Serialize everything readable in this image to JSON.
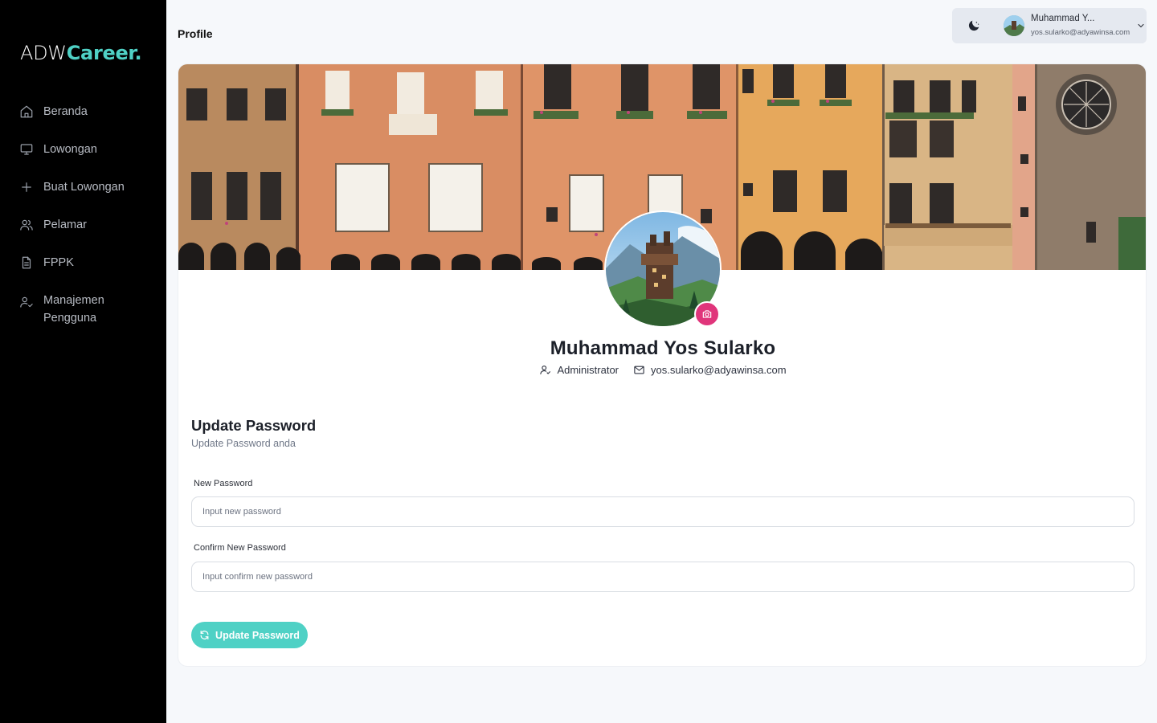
{
  "brand": {
    "prefix": "ADW",
    "accent": "Career."
  },
  "sidebar": {
    "items": [
      {
        "label": "Beranda",
        "icon": "home-icon"
      },
      {
        "label": "Lowongan",
        "icon": "monitor-icon"
      },
      {
        "label": "Buat Lowongan",
        "icon": "plus-icon"
      },
      {
        "label": "Pelamar",
        "icon": "users-icon"
      },
      {
        "label": "FPPK",
        "icon": "document-icon"
      },
      {
        "label": "Manajemen Pengguna",
        "icon": "user-check-icon"
      }
    ]
  },
  "header": {
    "title": "Profile",
    "user_name": "Muhammad Y...",
    "user_email": "yos.sularko@adyawinsa.com",
    "theme_icon": "moon-icon",
    "menu_icon": "chevron-down-icon"
  },
  "profile": {
    "name": "Muhammad Yos Sularko",
    "role": "Administrator",
    "email": "yos.sularko@adyawinsa.com",
    "camera_icon": "camera-icon"
  },
  "password_form": {
    "title": "Update Password",
    "subtitle": "Update Password anda",
    "new_label": "New Password",
    "new_placeholder": "Input new password",
    "confirm_label": "Confirm New Password",
    "confirm_placeholder": "Input confirm new password",
    "submit_label": "Update Password",
    "submit_icon": "refresh-icon"
  },
  "colors": {
    "accent": "#4fd1c5",
    "camera_button": "#e0357b",
    "sidebar_bg": "#000000",
    "page_bg": "#f6f8fb"
  }
}
